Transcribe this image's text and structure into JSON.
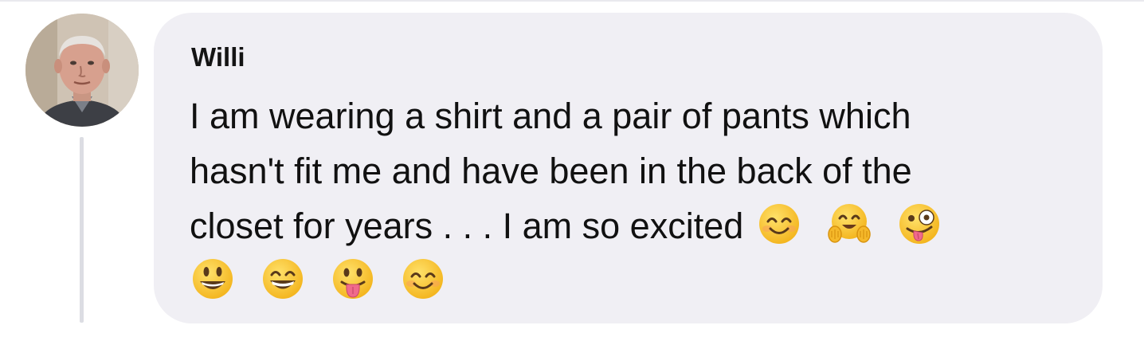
{
  "comment": {
    "author": "Willi",
    "lines": [
      "I am wearing a shirt and a pair of pants which",
      "hasn't fit me and have been in the back of the",
      "closet for years . . . I am so excited"
    ],
    "emojis_line3": [
      "smiling-face-icon",
      "hugging-face-icon",
      "zany-face-icon"
    ],
    "emojis_line4": [
      "grinning-face-icon",
      "grinning-squinting-eyes-icon",
      "face-with-tongue-icon",
      "smiling-face-icon"
    ]
  },
  "colors": {
    "bubble": "#f0eff4",
    "thread_line": "#dcdde3",
    "emoji_yellow": "#f8c526"
  }
}
